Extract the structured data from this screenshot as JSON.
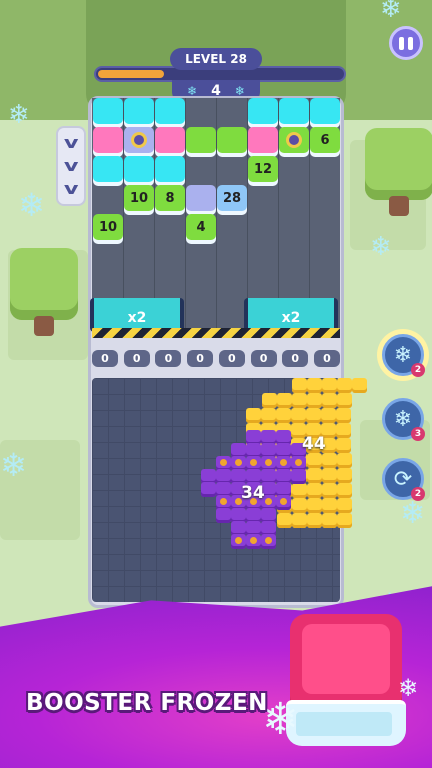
{
  "hud": {
    "level_label": "LEVEL 28",
    "progress_fraction": 0.27,
    "moves_count": "4",
    "snow_icon": "❄",
    "pause_icon": "pause-icon"
  },
  "lane_blocks": [
    {
      "col": 0,
      "row": 0,
      "color": "cyan",
      "label": ""
    },
    {
      "col": 1,
      "row": 0,
      "color": "cyan",
      "label": ""
    },
    {
      "col": 2,
      "row": 0,
      "color": "cyan",
      "label": ""
    },
    {
      "col": 5,
      "row": 0,
      "color": "cyan",
      "label": ""
    },
    {
      "col": 6,
      "row": 0,
      "color": "cyan",
      "label": ""
    },
    {
      "col": 7,
      "row": 0,
      "color": "cyan",
      "label": ""
    },
    {
      "col": 0,
      "row": 1,
      "color": "pink",
      "label": ""
    },
    {
      "col": 1,
      "row": 1,
      "color": "lav",
      "label": "",
      "orb": true
    },
    {
      "col": 2,
      "row": 1,
      "color": "pink",
      "label": ""
    },
    {
      "col": 3,
      "row": 1,
      "color": "green",
      "label": ""
    },
    {
      "col": 4,
      "row": 1,
      "color": "green",
      "label": ""
    },
    {
      "col": 5,
      "row": 1,
      "color": "pink",
      "label": ""
    },
    {
      "col": 6,
      "row": 1,
      "color": "green",
      "label": "",
      "orb": true
    },
    {
      "col": 7,
      "row": 1,
      "color": "green",
      "label": "6"
    },
    {
      "col": 0,
      "row": 2,
      "color": "cyan",
      "label": ""
    },
    {
      "col": 1,
      "row": 2,
      "color": "cyan",
      "label": ""
    },
    {
      "col": 2,
      "row": 2,
      "color": "cyan",
      "label": ""
    },
    {
      "col": 5,
      "row": 2,
      "color": "green",
      "label": "12"
    },
    {
      "col": 1,
      "row": 3,
      "color": "green",
      "label": "10"
    },
    {
      "col": 2,
      "row": 3,
      "color": "green",
      "label": "8"
    },
    {
      "col": 3,
      "row": 3,
      "color": "lav",
      "label": ""
    },
    {
      "col": 4,
      "row": 3,
      "color": "blue",
      "label": "28"
    },
    {
      "col": 0,
      "row": 4,
      "color": "green",
      "label": "10"
    },
    {
      "col": 3,
      "row": 4,
      "color": "green",
      "label": "4"
    }
  ],
  "multipliers": [
    "x2",
    "x2"
  ],
  "slots": [
    "0",
    "0",
    "0",
    "0",
    "0",
    "0",
    "0",
    "0"
  ],
  "clusters": {
    "yellow_count": "44",
    "purple_count": "34"
  },
  "boosters": [
    {
      "name": "freeze",
      "icon": "❄",
      "count": "2"
    },
    {
      "name": "snowflake-hammer",
      "icon": "❄",
      "count": "3"
    },
    {
      "name": "shuffle",
      "icon": "⟳",
      "count": "2"
    }
  ],
  "banner": {
    "title": "BOOSTER FROZEN"
  }
}
